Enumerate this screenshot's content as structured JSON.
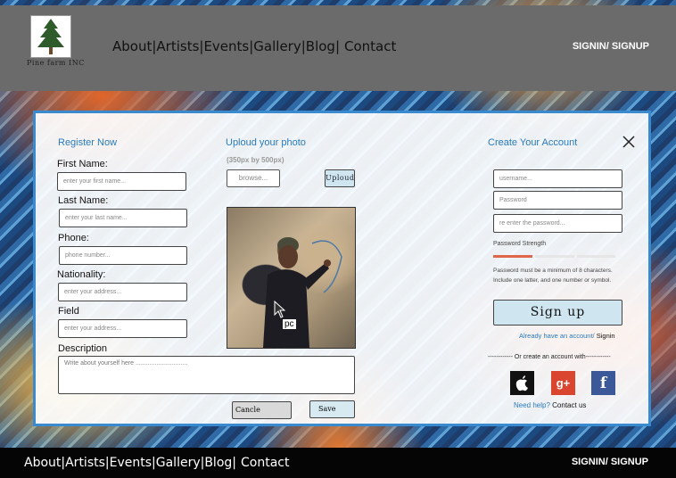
{
  "brand": {
    "name": "Pine farm INC"
  },
  "nav": {
    "items": [
      "About|",
      "Artists|",
      "Events|",
      "Gallery|",
      "Blog|",
      "Contact"
    ]
  },
  "auth_link": "SIGNIN/ SIGNUP",
  "register": {
    "heading": "Register Now",
    "fields": [
      {
        "label": "First Name:",
        "placeholder": "enter your first name..."
      },
      {
        "label": "Last Name:",
        "placeholder": "enter your last name..."
      },
      {
        "label": "Phone:",
        "placeholder": "phone number..."
      },
      {
        "label": "Nationality:",
        "placeholder": "enter your address..."
      },
      {
        "label": "Field",
        "placeholder": "enter your address..."
      }
    ],
    "description_label": "Description",
    "description_placeholder": "Write about yourself here ..............................",
    "cancel_label": "Cancle",
    "save_label": "Save"
  },
  "upload": {
    "heading": "Uploud your photo",
    "size_hint": "(350px by 500px)",
    "browse_label": "browse...",
    "upload_label": "Uploud",
    "photo_caption": "pc"
  },
  "account": {
    "heading": "Create Your Account",
    "username_placeholder": "username...",
    "password_placeholder": "Password",
    "reenter_placeholder": "re enter the password...",
    "strength_label": "Password Strength",
    "rules_text": "Password must be a minimum of 8 characters. Include one latter, and one number or symbol.",
    "signup_label": "Sign up",
    "already_text": "Already have an account/",
    "signin_text": "Signin",
    "or_text": "------------ Or  create an account with------------",
    "help_text": "Need help?",
    "contact_text": "Contact us",
    "social": [
      "apple-icon",
      "google-plus-icon",
      "facebook-icon"
    ],
    "social_colors": {
      "apple": "#111111",
      "google": "#d9452f",
      "facebook": "#3b5998"
    }
  },
  "colors": {
    "accent": "#2a7ab8",
    "header": "#6b6b6b",
    "footer": "#050505",
    "strength_bar": "#e0664a"
  }
}
